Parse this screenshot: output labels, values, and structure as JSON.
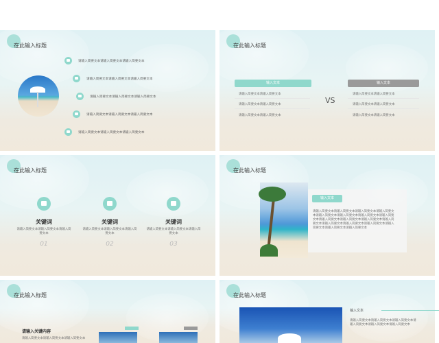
{
  "colors": {
    "accent": "#8fd8cc",
    "gray_header": "#9a9a9a",
    "title_circle": "#9fdcd4"
  },
  "slide1": {
    "title": "在此输入标题",
    "items": [
      {
        "icon": "monitor-icon",
        "text": "请输入简要文本请输入简要文本请输入简要文本"
      },
      {
        "icon": "printer-icon",
        "text": "请输入简要文本请输入简要文本请输入简要文本"
      },
      {
        "icon": "gear-icon",
        "text": "请输入简要文本请输入简要文本请输入简要文本"
      },
      {
        "icon": "globe-icon",
        "text": "请输入简要文本请输入简要文本请输入简要文本"
      },
      {
        "icon": "card-icon",
        "text": "请输入简要文本请输入简要文本请输入简要文本"
      }
    ]
  },
  "slide2": {
    "title": "在此输入标题",
    "left_header": "输入文本",
    "right_header": "输入文本",
    "vs": "VS",
    "left_rows": [
      "请输入简要文本请输入简要文本",
      "请输入简要文本请输入简要文本",
      "请输入简要文本请输入简要文本"
    ],
    "right_rows": [
      "请输入简要文本请输入简要文本",
      "请输入简要文本请输入简要文本",
      "请输入简要文本请输入简要文本"
    ]
  },
  "slide3": {
    "title": "在此输入标题",
    "keywords": [
      {
        "icon": "briefcase-icon",
        "label": "关键词",
        "desc": "请输入简要文本请输入简要文本请输入简要文本",
        "num": "01"
      },
      {
        "icon": "cube-icon",
        "label": "关键词",
        "desc": "请输入简要文本请输入简要文本请输入简要文本",
        "num": "02"
      },
      {
        "icon": "location-icon",
        "label": "关键词",
        "desc": "请输入简要文本请输入简要文本请输入简要文本",
        "num": "03"
      }
    ]
  },
  "slide4": {
    "title": "在此输入标题",
    "panel_header": "输入文本",
    "panel_body": "请输入简要文本请输入简要文本请输入简要文本请输入简要文本请输入简要文本请输入简要文本请输入简要文本请输入简要文本请输入简要文本请输入简要文本请输入简要文本请输入简要文本请输入简要文本请输入简要文本请输入简要文本请输入简要文本请输入简要文本请输入简要文本"
  },
  "slide5": {
    "title": "在此输入标题",
    "heading": "请输入关键内容",
    "body": "请输入简要文本请输入简要文本请输入简要文本"
  },
  "slide6": {
    "title": "在此输入标题",
    "label": "输入文本",
    "body": "请输入简要文本请输入简要文本请输入简要文本请输入简要文本请输入简要文本请输入简要文本"
  }
}
